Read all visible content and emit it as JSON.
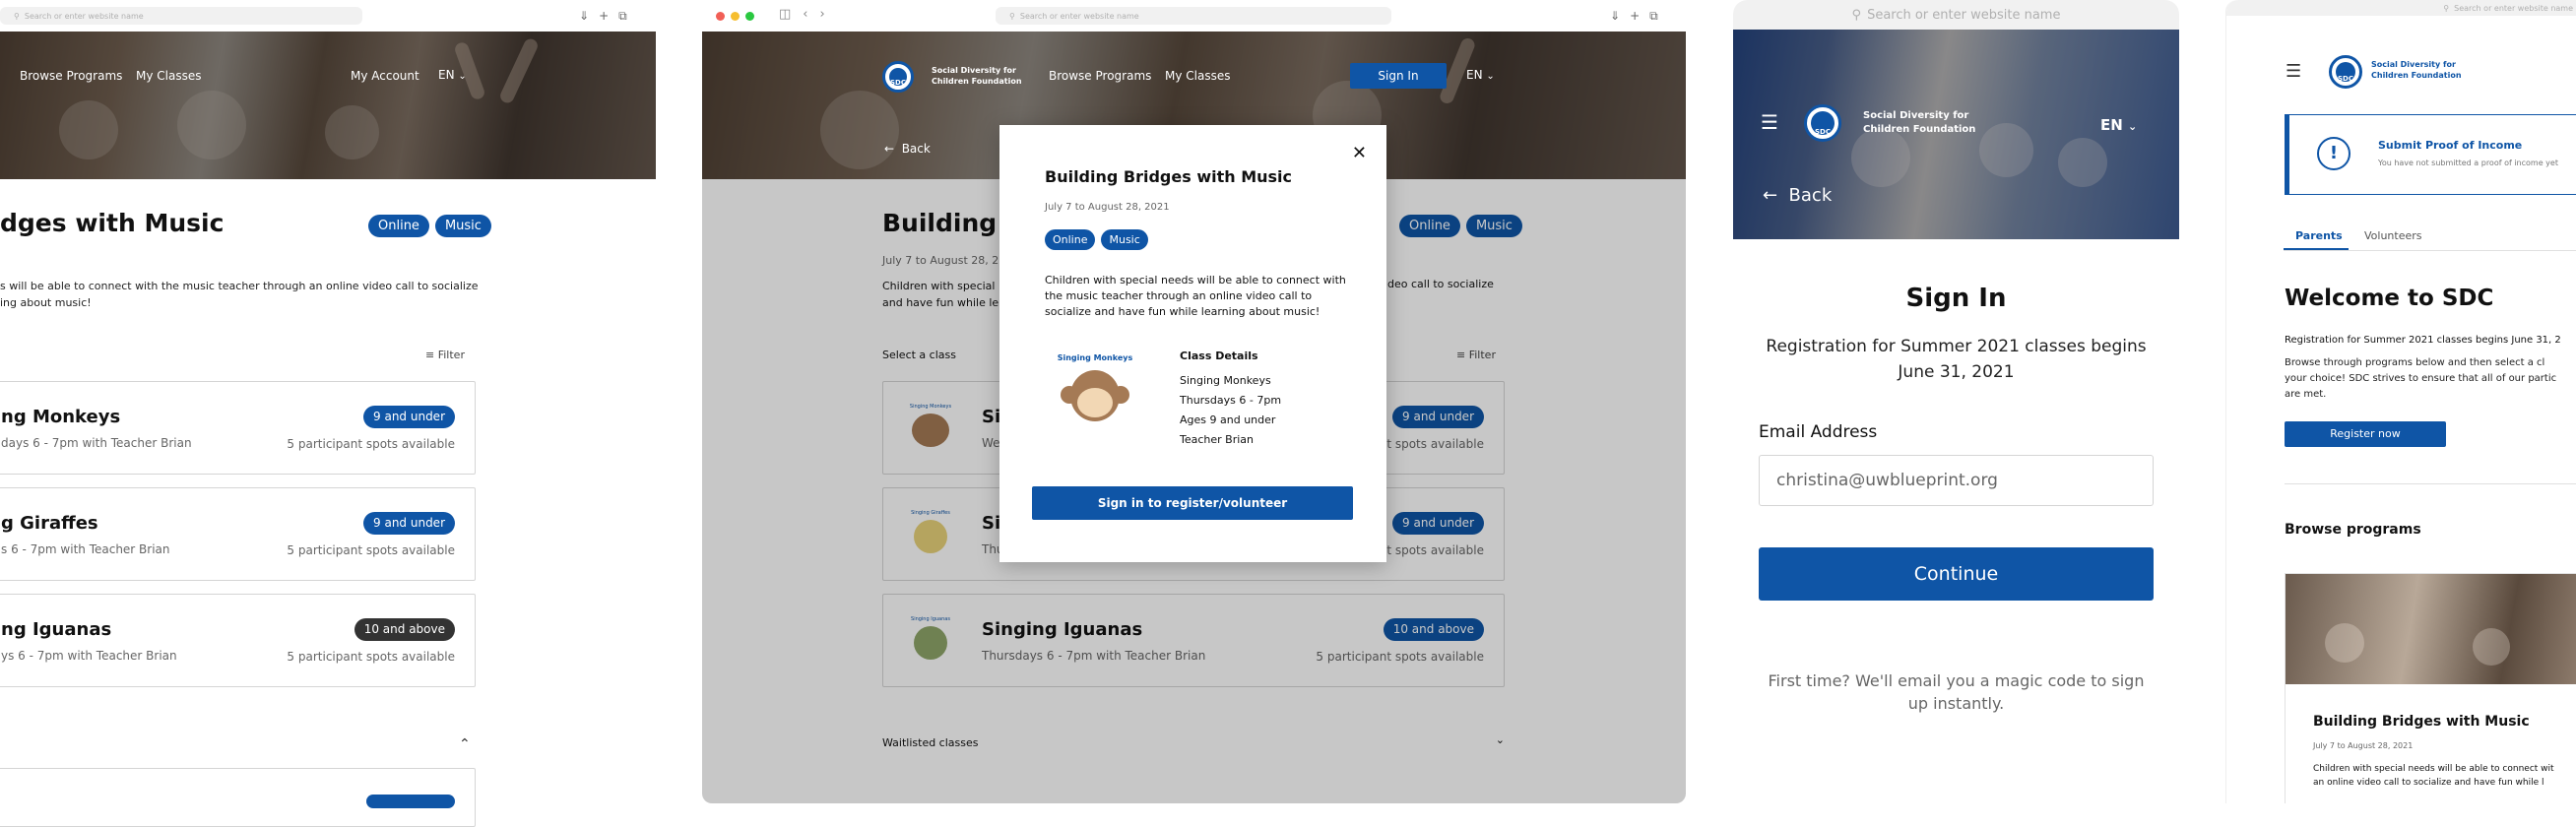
{
  "search_placeholder": "Search or enter website name",
  "colors": {
    "brand": "#0f55a6",
    "dark_badge": "#333333",
    "border": "#d5d5d5"
  },
  "panel1": {
    "nav": {
      "browse": "Browse Programs",
      "classes": "My Classes",
      "account": "My Account",
      "lang": "EN"
    },
    "title": "dges with Music",
    "tags": [
      "Online",
      "Music"
    ],
    "desc": "s will be able to connect with the music teacher through an online video call to socialize\ning about music!",
    "filter": "Filter",
    "classes": [
      {
        "name": "ng Monkeys",
        "time": "days 6 - 7pm with Teacher Brian",
        "age": "9 and under",
        "spots": "5 participant spots available",
        "dark": false
      },
      {
        "name": "g Giraffes",
        "time": "s 6 - 7pm with Teacher Brian",
        "age": "9 and under",
        "spots": "5 participant spots available",
        "dark": false
      },
      {
        "name": "ng Iguanas",
        "time": "ys 6 - 7pm with Teacher Brian",
        "age": "10 and above",
        "spots": "5 participant spots available",
        "dark": true
      }
    ]
  },
  "panel2": {
    "org": "Social Diversity for\nChildren Foundation",
    "logo_text": "SDC",
    "nav": {
      "browse": "Browse Programs",
      "classes": "My Classes",
      "signin": "Sign In",
      "lang": "EN"
    },
    "back": "Back",
    "title_partial": "Building B",
    "dates_partial": "July 7 to August 28, 20",
    "desc_left": "Children with special\nand have fun while le",
    "desc_right": "deo call to socialize",
    "tags": [
      "Online",
      "Music"
    ],
    "select_class": "Select a class",
    "filter": "Filter",
    "classes": [
      {
        "name": "Sin",
        "time": "We",
        "age": "9 and under",
        "spots": "nt spots available",
        "thumb_label": "Singing Monkeys"
      },
      {
        "name": "Sin",
        "time": "Thu",
        "age": "9 and under",
        "spots": "nt spots available",
        "thumb_label": "Singing Giraffes"
      },
      {
        "name": "Singing Iguanas",
        "time": "Thursdays 6 - 7pm with Teacher Brian",
        "age": "10 and above",
        "spots": "5 participant spots available",
        "thumb_label": "Singing Iguanas"
      }
    ],
    "waitlisted": "Waitlisted classes",
    "modal": {
      "title": "Building Bridges with Music",
      "dates": "July 7 to August 28, 2021",
      "tags": [
        "Online",
        "Music"
      ],
      "desc": "Children with special needs will be able to connect with the music teacher through an online video call to socialize and have fun while learning about music!",
      "thumb_label": "Singing Monkeys",
      "details_title": "Class Details",
      "details": [
        "Singing Monkeys",
        "Thursdays 6 - 7pm",
        "Ages 9 and under",
        "Teacher Brian"
      ],
      "cta": "Sign in to register/volunteer"
    }
  },
  "panel3": {
    "logo_text": "SDC",
    "org": "Social Diversity for\nChildren Foundation",
    "lang": "EN",
    "back": "Back",
    "title": "Sign In",
    "subtitle": "Registration for Summer 2021 classes begins June 31, 2021",
    "email_label": "Email Address",
    "email_value": "christina@uwblueprint.org",
    "continue": "Continue",
    "footnote": "First time? We'll email you a magic code to sign up instantly."
  },
  "panel4": {
    "logo_text": "SDC",
    "org": "Social Diversity for\nChildren Foundation",
    "alert_title": "Submit Proof of Income",
    "alert_sub": "You have not submitted a proof of income yet",
    "tabs": [
      "Parents",
      "Volunteers"
    ],
    "title": "Welcome to SDC",
    "reg_line": "Registration for Summer 2021 classes begins June 31, 2",
    "browse_text": "Browse through programs below and then select a cl\nyour choice! SDC strives to ensure that all of our partic\nare met.",
    "register_btn": "Register now",
    "browse_heading": "Browse programs",
    "card_title": "Building Bridges with Music",
    "card_dates": "July 7 to August 28, 2021",
    "card_desc": "Children with special needs will be able to connect wit\nan online video call to socialize and have fun while l"
  }
}
